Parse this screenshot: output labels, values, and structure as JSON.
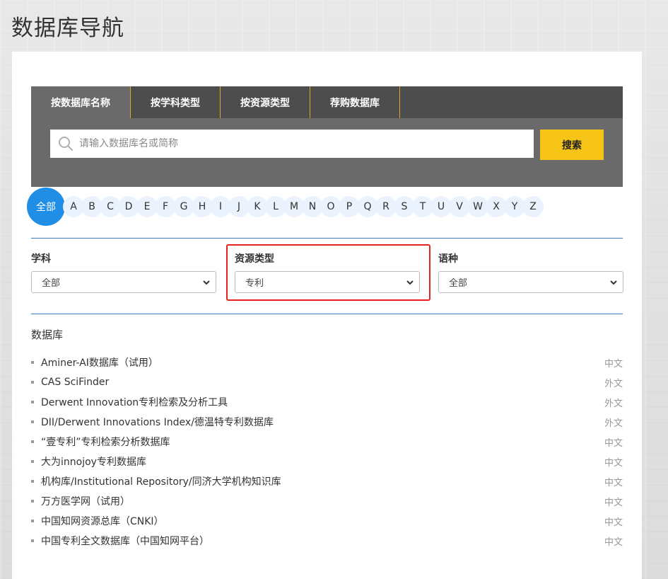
{
  "page_title": "数据库导航",
  "tabs": [
    {
      "label": "按数据库名称",
      "active": true
    },
    {
      "label": "按学科类型",
      "active": false
    },
    {
      "label": "按资源类型",
      "active": false
    },
    {
      "label": "荐购数据库",
      "active": false
    }
  ],
  "search": {
    "placeholder": "请输入数据库名或简称",
    "value": "",
    "button_label": "搜索"
  },
  "alphabet": {
    "all_label": "全部",
    "letters": [
      "A",
      "B",
      "C",
      "D",
      "E",
      "F",
      "G",
      "H",
      "I",
      "J",
      "K",
      "L",
      "M",
      "N",
      "O",
      "P",
      "Q",
      "R",
      "S",
      "T",
      "U",
      "V",
      "W",
      "X",
      "Y",
      "Z"
    ]
  },
  "filters": {
    "subject": {
      "label": "学科",
      "selected": "全部"
    },
    "resource_type": {
      "label": "资源类型",
      "selected": "专利"
    },
    "language": {
      "label": "语种",
      "selected": "全部"
    }
  },
  "databases": {
    "heading": "数据库",
    "items": [
      {
        "name": "Aminer-AI数据库（试用）",
        "lang": "中文"
      },
      {
        "name": "CAS SciFinder",
        "lang": "外文"
      },
      {
        "name": "Derwent Innovation专利检索及分析工具",
        "lang": "外文"
      },
      {
        "name": "DII/Derwent Innovations Index/德温特专利数据库",
        "lang": "外文"
      },
      {
        "name": "“壹专利”专利检索分析数据库",
        "lang": "中文"
      },
      {
        "name": "大为innojoy专利数据库",
        "lang": "中文"
      },
      {
        "name": "机构库/Institutional Repository/同济大学机构知识库",
        "lang": "中文"
      },
      {
        "name": "万方医学网（试用）",
        "lang": "中文"
      },
      {
        "name": "中国知网资源总库（CNKI）",
        "lang": "中文"
      },
      {
        "name": "中国专利全文数据库（中国知网平台）",
        "lang": "中文"
      }
    ]
  },
  "colors": {
    "accent_blue": "#1f8ee4",
    "search_button": "#f6c317",
    "highlight_red": "#e8231b",
    "tab_bar": "#4d4d4d"
  }
}
